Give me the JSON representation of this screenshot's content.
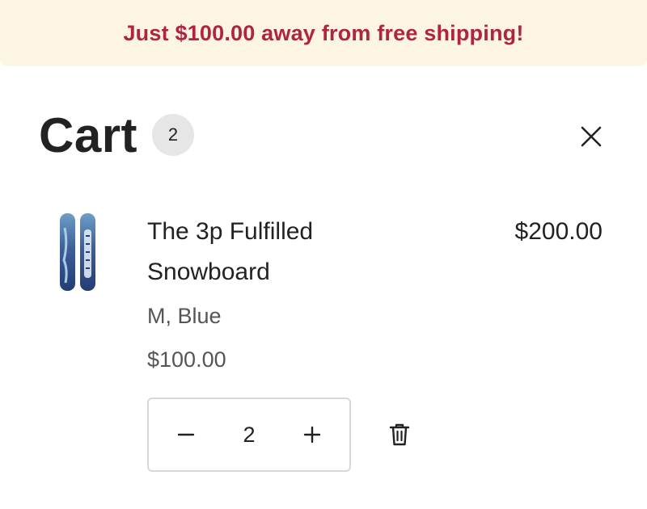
{
  "banner": {
    "text": "Just $100.00 away from free shipping!"
  },
  "colors": {
    "banner_bg": "#fcf5e4",
    "banner_text": "#b0243f",
    "count_badge_bg": "#e6e6e6"
  },
  "header": {
    "title": "Cart",
    "count": "2",
    "close_icon": "close-icon"
  },
  "items": [
    {
      "title": "The 3p Fulfilled Snowboard",
      "variant": "M, Blue",
      "unit_price": "$100.00",
      "line_total": "$200.00",
      "quantity": "2",
      "image_icon": "snowboard-image",
      "minus_icon": "minus-icon",
      "plus_icon": "plus-icon",
      "delete_icon": "trash-icon"
    }
  ]
}
